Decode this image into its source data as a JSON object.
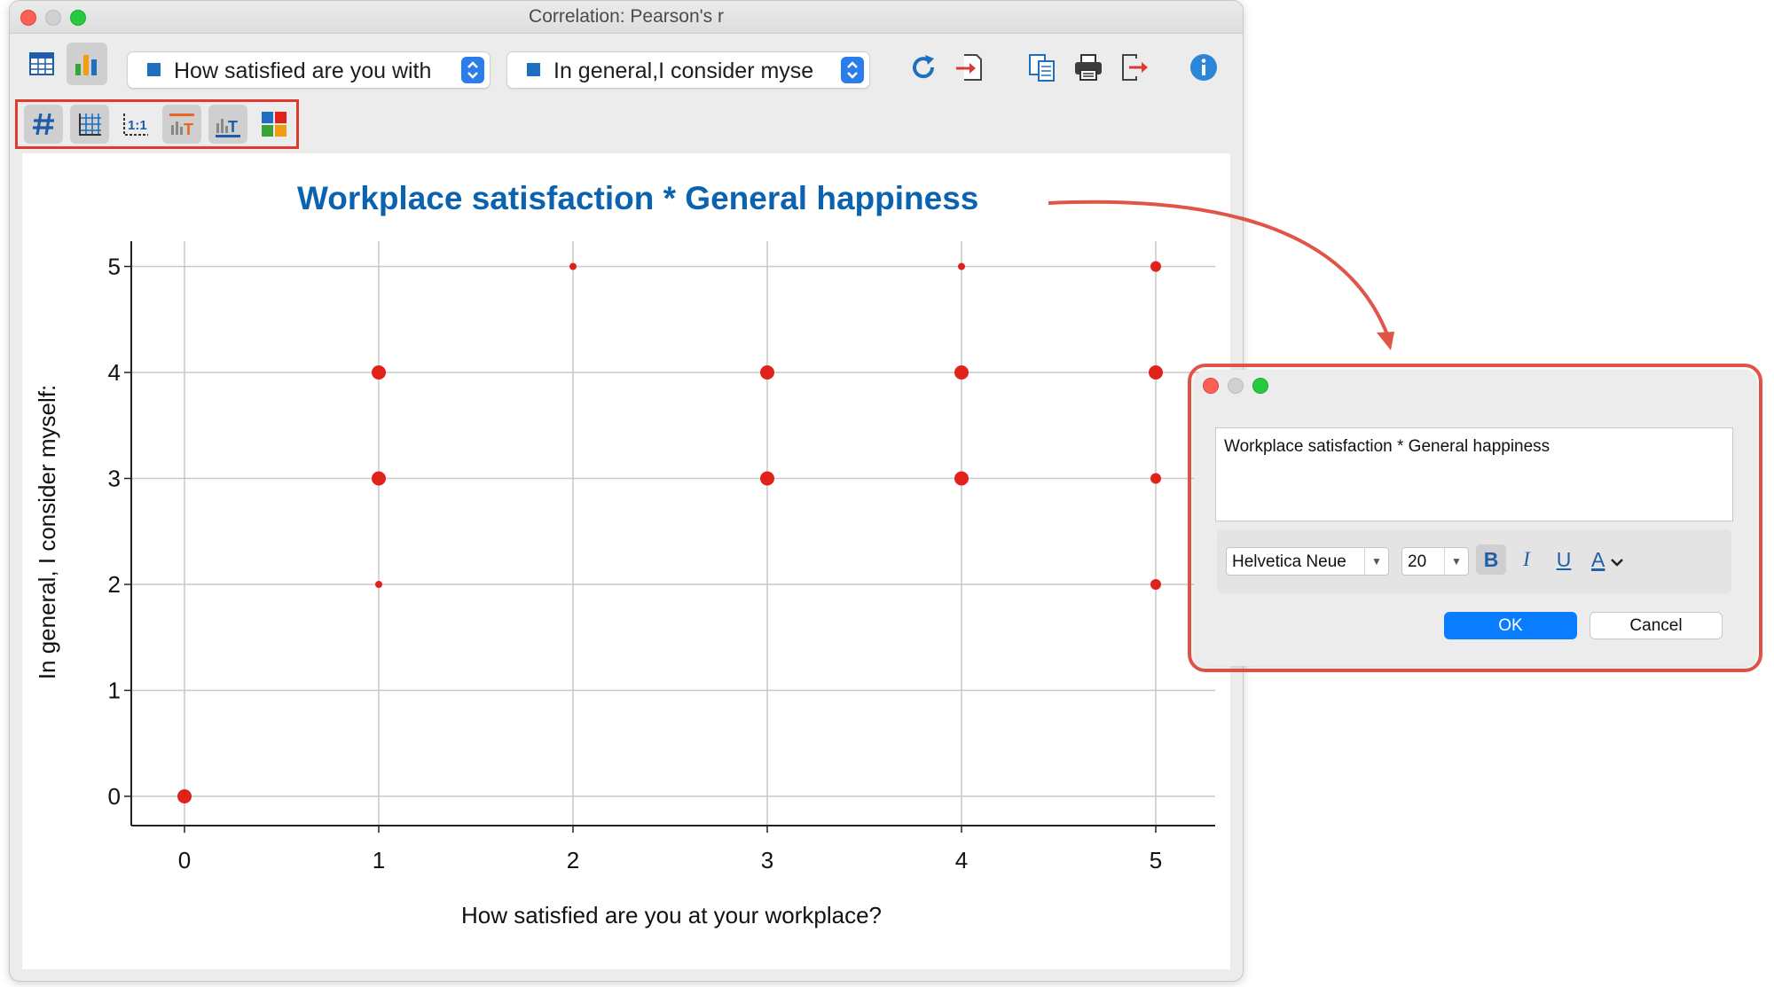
{
  "window": {
    "title": "Correlation: Pearson's r"
  },
  "toolbar": {
    "var_x_select": "How satisfied are you with",
    "var_y_select": "In general,I consider myse",
    "icons": [
      "table-icon",
      "chart-icon",
      "refresh-icon",
      "import-icon",
      "copy-icon",
      "print-icon",
      "export-icon",
      "info-icon"
    ]
  },
  "chart_toolbar": {
    "icons": [
      "hash-icon",
      "grid-icon",
      "aspect-ratio-icon",
      "title-format-icon",
      "axis-label-icon",
      "color-palette-icon"
    ]
  },
  "chart_data": {
    "type": "scatter",
    "title": "Workplace satisfaction * General happiness",
    "xlabel": "How satisfied are you at your workplace?",
    "ylabel": "In general, I consider myself:",
    "xticks": [
      "0",
      "1",
      "2",
      "3",
      "4",
      "5"
    ],
    "yticks": [
      "0",
      "1",
      "2",
      "3",
      "4",
      "5"
    ],
    "xlim": [
      0,
      5
    ],
    "ylim": [
      0,
      5
    ],
    "grid": true,
    "point_color": "#e0221b",
    "title_color": "#0b63b0",
    "points": [
      {
        "x": 0,
        "y": 0,
        "size": "large"
      },
      {
        "x": 1,
        "y": 2,
        "size": "small"
      },
      {
        "x": 1,
        "y": 3,
        "size": "large"
      },
      {
        "x": 1,
        "y": 4,
        "size": "large"
      },
      {
        "x": 2,
        "y": 5,
        "size": "small"
      },
      {
        "x": 3,
        "y": 3,
        "size": "large"
      },
      {
        "x": 3,
        "y": 4,
        "size": "large"
      },
      {
        "x": 4,
        "y": 3,
        "size": "large"
      },
      {
        "x": 4,
        "y": 4,
        "size": "large"
      },
      {
        "x": 4,
        "y": 5,
        "size": "small"
      },
      {
        "x": 5,
        "y": 2,
        "size": "medium"
      },
      {
        "x": 5,
        "y": 3,
        "size": "medium"
      },
      {
        "x": 5,
        "y": 4,
        "size": "large"
      },
      {
        "x": 5,
        "y": 5,
        "size": "medium"
      }
    ]
  },
  "dialog": {
    "text_value": "Workplace satisfaction * General happiness",
    "font_family": "Helvetica Neue",
    "font_size": "20",
    "bold_label": "B",
    "italic_label": "I",
    "underline_label": "U",
    "color_label": "A",
    "ok_label": "OK",
    "cancel_label": "Cancel"
  },
  "colors": {
    "accent_blue": "#0a7cff",
    "highlight_red": "#e03a2f"
  }
}
